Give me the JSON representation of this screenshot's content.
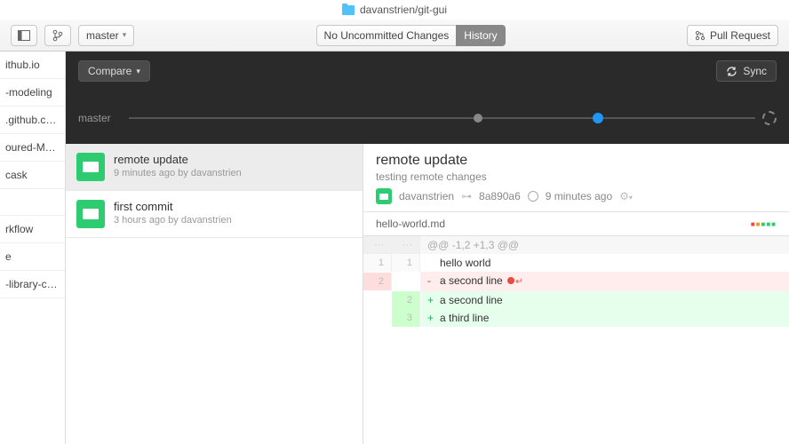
{
  "title": {
    "repo_path": "davanstrien/git-gui"
  },
  "toolbar": {
    "branch": "master",
    "seg_left": "No Uncommitted Changes",
    "seg_right": "History",
    "pull_request": "Pull Request"
  },
  "dark": {
    "compare": "Compare",
    "sync": "Sync",
    "timeline_label": "master"
  },
  "repos": [
    "ithub.io",
    "-modeling",
    ".github.c…",
    "oured-M…",
    "cask",
    "",
    "rkflow",
    "e",
    "-library-c…"
  ],
  "commits": [
    {
      "title": "remote update",
      "meta": "9 minutes ago by davanstrien",
      "selected": true
    },
    {
      "title": "first commit",
      "meta": "3 hours ago by davanstrien",
      "selected": false
    }
  ],
  "detail": {
    "title": "remote update",
    "desc": "testing remote changes",
    "author": "davanstrien",
    "sha": "8a890a6",
    "time": "9 minutes ago",
    "file": "hello-world.md",
    "hunk": "@@ -1,2 +1,3 @@",
    "lines": [
      {
        "type": "ctx",
        "old": "1",
        "new": "1",
        "text": "hello world"
      },
      {
        "type": "del",
        "old": "2",
        "new": "",
        "text": "a second line ",
        "trail": true
      },
      {
        "type": "add",
        "old": "",
        "new": "2",
        "text": "a second line"
      },
      {
        "type": "add",
        "old": "",
        "new": "3",
        "text": "a third line"
      }
    ]
  }
}
